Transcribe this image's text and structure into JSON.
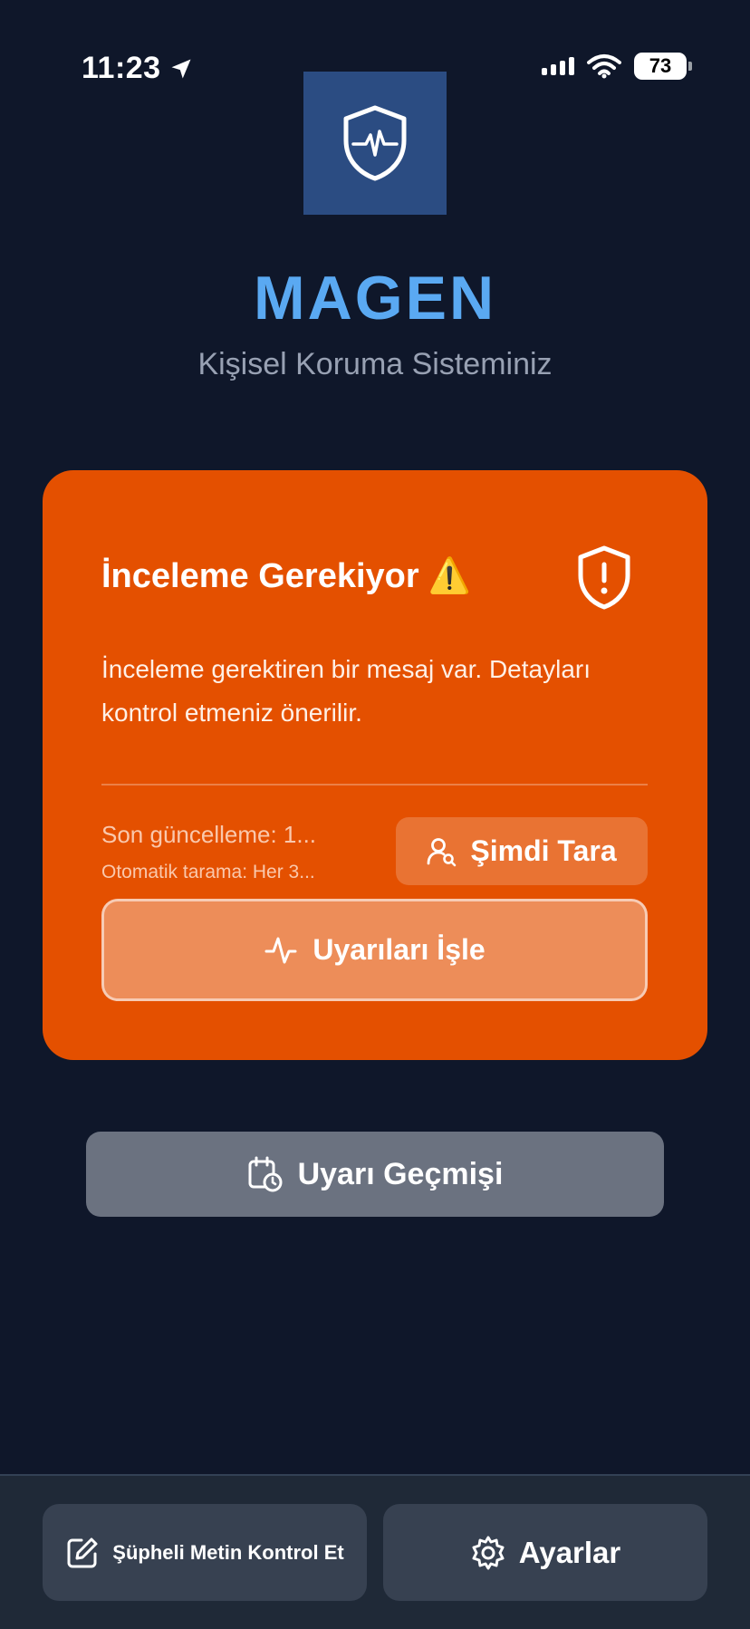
{
  "status_bar": {
    "time": "11:23",
    "battery": "73"
  },
  "header": {
    "title": "MAGEN",
    "subtitle": "Kişisel Koruma Sisteminiz",
    "logo_icon": "shield-pulse-icon"
  },
  "status_card": {
    "title": "İnceleme Gerekiyor",
    "title_emoji": "⚠️",
    "message": "İnceleme gerektiren bir mesaj var. Detayları kontrol etmeniz önerilir.",
    "last_update": "Son güncelleme: 1...",
    "auto_scan": "Otomatik tarama: Her 3...",
    "scan_button": "Şimdi Tara",
    "process_button": "Uyarıları İşle",
    "background_color": "#e45000"
  },
  "history_button": "Uyarı Geçmişi",
  "bottom_bar": {
    "check_text_button": "Şüpheli Metin Kontrol Et",
    "settings_button": "Ayarlar"
  },
  "colors": {
    "background": "#0f172a",
    "accent": "#5aa9f2",
    "warning": "#e45000"
  }
}
